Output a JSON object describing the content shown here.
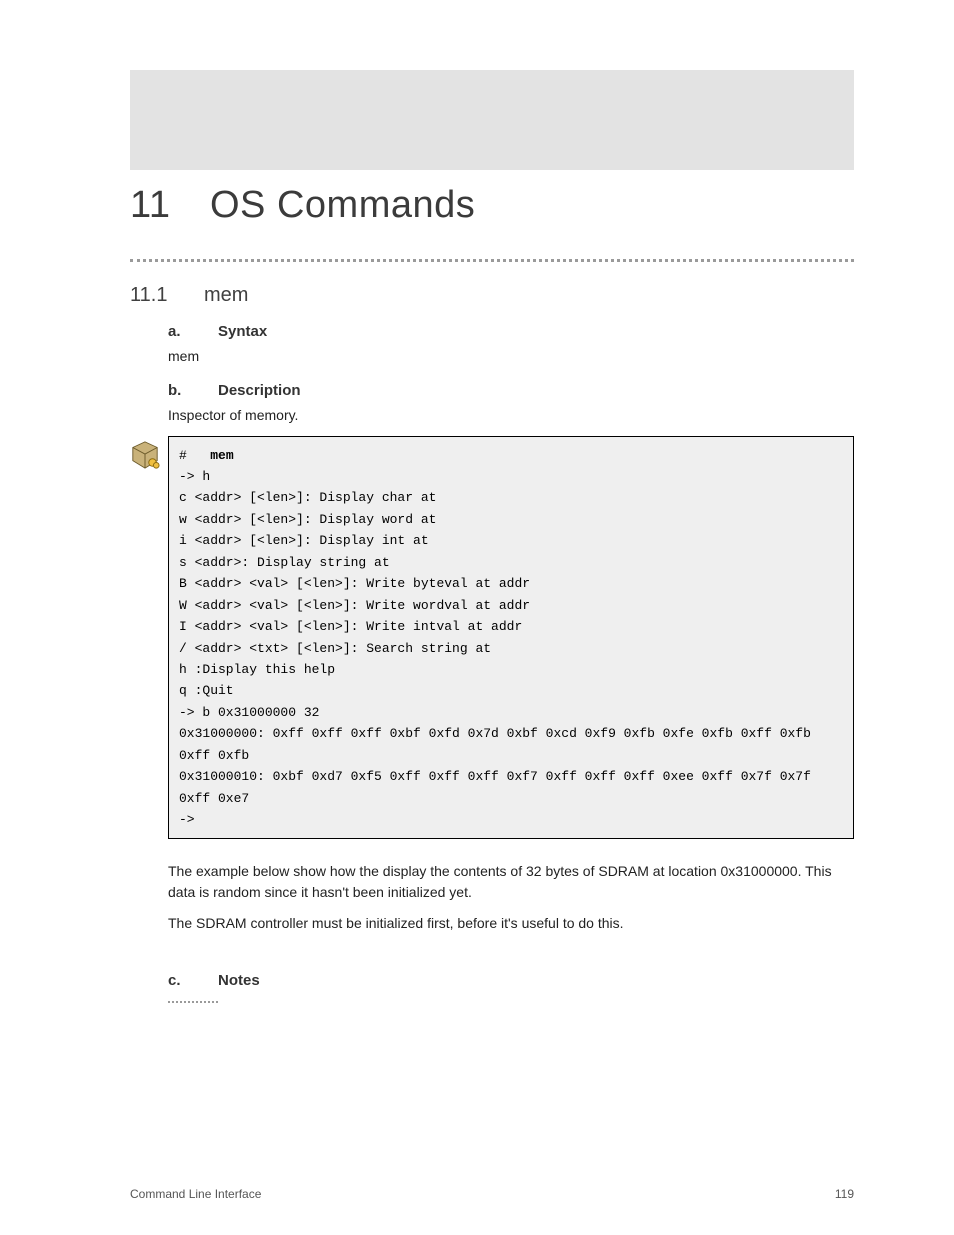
{
  "chapter": {
    "num": "11",
    "title": "OS Commands"
  },
  "sec_h2": {
    "num": "11.1",
    "title": "mem"
  },
  "sec_h3_syntax": {
    "num": "a.",
    "title": "Syntax"
  },
  "intro_syntax": "mem",
  "sec_h3_desc": {
    "num": "b.",
    "title": "Description"
  },
  "intro_desc": "Inspector of memory.",
  "code": {
    "prompt": "#",
    "cmd": "mem",
    "lines": [
      "-> h",
      "c <addr> [<len>]: Display char at",
      "w <addr> [<len>]: Display word at",
      "i <addr> [<len>]: Display int at",
      "s <addr>: Display string at",
      "B <addr> <val> [<len>]: Write byteval at addr",
      "W <addr> <val> [<len>]: Write wordval at addr",
      "I <addr> <val> [<len>]: Write intval at addr",
      "/ <addr> <txt> [<len>]: Search string at",
      "h :Display this help",
      "q :Quit",
      "-> b 0x31000000 32",
      "0x31000000: 0xff 0xff 0xff 0xbf 0xfd 0x7d 0xbf 0xcd 0xf9 0xfb 0xfe 0xfb 0xff 0xfb 0xff 0xfb",
      "0x31000010: 0xbf 0xd7 0xf5 0xff 0xff 0xff 0xf7 0xff 0xff 0xff 0xee 0xff 0x7f 0x7f 0xff 0xe7",
      "->"
    ]
  },
  "body1": "The example below show how the display the contents of 32 bytes of SDRAM at location 0x31000000. This data is random since it hasn't been initialized yet.",
  "body2": "The SDRAM controller must be initialized first, before it's useful to do this.",
  "sec_h3_notes": {
    "num": "c.",
    "title": "Notes"
  },
  "footer": {
    "left": "Command Line Interface",
    "right": "119"
  }
}
